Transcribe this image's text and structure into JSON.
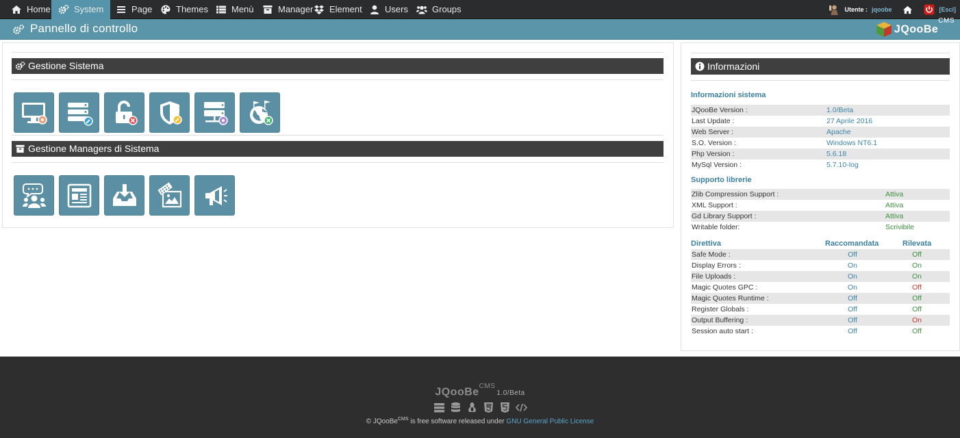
{
  "nav": {
    "items": [
      {
        "label": "Home",
        "icon": "home-icon"
      },
      {
        "label": "System",
        "icon": "gears-icon"
      },
      {
        "label": "Page",
        "icon": "list-icon"
      },
      {
        "label": "Themes",
        "icon": "palette-icon"
      },
      {
        "label": "Menù",
        "icon": "menu-list-icon"
      },
      {
        "label": "Manager",
        "icon": "archive-icon"
      },
      {
        "label": "Element",
        "icon": "dropbox-icon"
      },
      {
        "label": "Users",
        "icon": "user-icon"
      },
      {
        "label": "Groups",
        "icon": "users-icon"
      }
    ],
    "active": "System",
    "user_label": "Utente :",
    "user_name": "jqoobe",
    "logout_label": "[Esci]"
  },
  "header": {
    "title": "Pannello di controllo",
    "brand": "JQooBe",
    "brand_sup": "CMS"
  },
  "sections": {
    "system": {
      "title": "Gestione Sistema"
    },
    "managers": {
      "title": "Gestione Managers di Sistema"
    }
  },
  "info": {
    "title": "Informazioni",
    "system_heading": "Informazioni sistema",
    "system_rows": [
      {
        "label": "JQooBe Version :",
        "value": "1.0/Beta"
      },
      {
        "label": "Last Update :",
        "value": "27 Aprile 2016"
      },
      {
        "label": "Web Server :",
        "value": "Apache"
      },
      {
        "label": "S.O. Version :",
        "value": "Windows NT6.1"
      },
      {
        "label": "Php Version :",
        "value": "5.6.18"
      },
      {
        "label": "MySql Version :",
        "value": "5.7.10-log"
      }
    ],
    "libs_heading": "Supporto librerie",
    "libs_rows": [
      {
        "label": "Zlib Compression Support :",
        "value": "Attiva"
      },
      {
        "label": "XML Support :",
        "value": "Attiva"
      },
      {
        "label": "Gd Library Support :",
        "value": "Attiva"
      },
      {
        "label": "Writable folder:",
        "value": "Scrivibile"
      }
    ],
    "directive_headings": {
      "name": "Direttiva",
      "recommended": "Raccomandata",
      "detected": "Rilevata"
    },
    "directive_rows": [
      {
        "label": "Safe Mode :",
        "rec": "Off",
        "det": "Off",
        "ok": true
      },
      {
        "label": "Display Errors :",
        "rec": "On",
        "det": "On",
        "ok": true
      },
      {
        "label": "File Uploads :",
        "rec": "On",
        "det": "On",
        "ok": true
      },
      {
        "label": "Magic Quotes GPC :",
        "rec": "On",
        "det": "Off",
        "ok": false
      },
      {
        "label": "Magic Quotes Runtime :",
        "rec": "Off",
        "det": "Off",
        "ok": true
      },
      {
        "label": "Register Globals :",
        "rec": "Off",
        "det": "Off",
        "ok": true
      },
      {
        "label": "Output Buffering :",
        "rec": "Off",
        "det": "On",
        "ok": false
      },
      {
        "label": "Session auto start :",
        "rec": "Off",
        "det": "Off",
        "ok": true
      }
    ]
  },
  "footer": {
    "brand": "JQooBe",
    "brand_sup": "CMS",
    "version": "1.0/Beta",
    "copyright_prefix": "© JQooBe",
    "copyright_sup": "CMS",
    "copyright_mid": " is free software released under ",
    "license": "GNU General Public License"
  }
}
